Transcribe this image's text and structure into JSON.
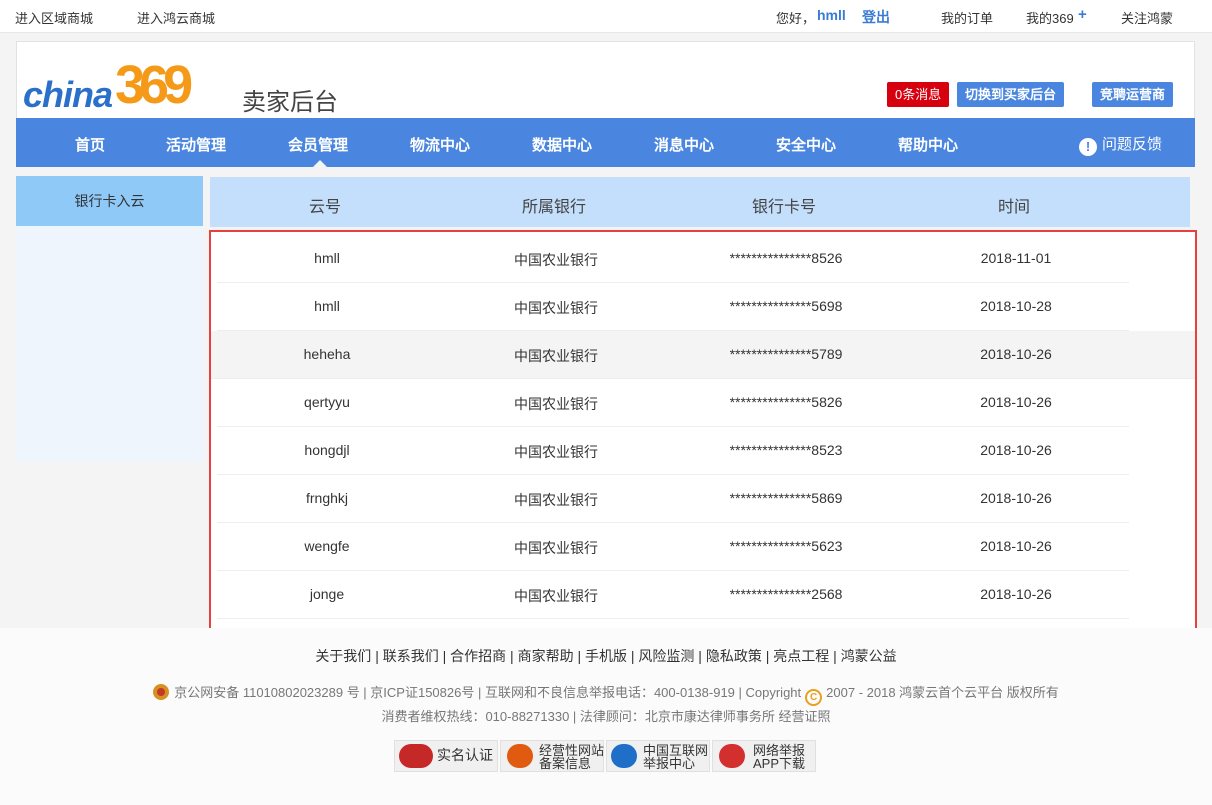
{
  "topbar": {
    "regional_mall": "进入区域商城",
    "hongyun_mall": "进入鸿云商城",
    "greeting": "您好，",
    "username": "hmll",
    "logout": "登出",
    "my_orders": "我的订单",
    "my369": "我的369",
    "plus": "+",
    "follow": "关注鸿蒙"
  },
  "header": {
    "logo_text": "china",
    "logo_num": "369",
    "title": "卖家后台",
    "messages": "0条消息",
    "switch_buyer": "切换到买家后台",
    "bid_operator": "竞聘运营商"
  },
  "nav": {
    "items": [
      "首页",
      "活动管理",
      "会员管理",
      "物流中心",
      "数据中心",
      "消息中心",
      "安全中心",
      "帮助中心"
    ],
    "active": "会员管理",
    "feedback": "问题反馈"
  },
  "sidebar": {
    "items": [
      "银行卡入云"
    ]
  },
  "table": {
    "headers": [
      "云号",
      "所属银行",
      "银行卡号",
      "时间"
    ],
    "rows": [
      [
        "hmll",
        "中国农业银行",
        "***************8526",
        "2018-11-01"
      ],
      [
        "hmll",
        "中国农业银行",
        "***************5698",
        "2018-10-28"
      ],
      [
        "heheha",
        "中国农业银行",
        "***************5789",
        "2018-10-26"
      ],
      [
        "qertyyu",
        "中国农业银行",
        "***************5826",
        "2018-10-26"
      ],
      [
        "hongdjl",
        "中国农业银行",
        "***************8523",
        "2018-10-26"
      ],
      [
        "frnghkj",
        "中国农业银行",
        "***************5869",
        "2018-10-26"
      ],
      [
        "wengfe",
        "中国农业银行",
        "***************5623",
        "2018-10-26"
      ],
      [
        "jonge",
        "中国农业银行",
        "***************2568",
        "2018-10-26"
      ]
    ]
  },
  "footer": {
    "links": [
      "关于我们",
      "联系我们",
      "合作招商",
      "商家帮助",
      "手机版",
      "风险监测",
      "隐私政策",
      "亮点工程",
      "鸿蒙公益"
    ],
    "line2_a": "京公网安备 11010802023289 号 | 京ICP证150826号 | 互联网和不良信息举报电话：400-0138-919 | Copyright",
    "copyright_symbol": "C",
    "line2_b": "2007 - 2018 鸿蒙云首个云平台 版权所有",
    "line3": "消费者维权热线：010-88271330 | 法律顾问：北京市康达律师事务所    经营证照",
    "badges": [
      {
        "line1": "实名认证",
        "line2": ""
      },
      {
        "line1": "经营性网站",
        "line2": "备案信息"
      },
      {
        "line1": "中国互联网",
        "line2": "举报中心"
      },
      {
        "line1": "网络举报",
        "line2": "APP下载"
      }
    ]
  }
}
